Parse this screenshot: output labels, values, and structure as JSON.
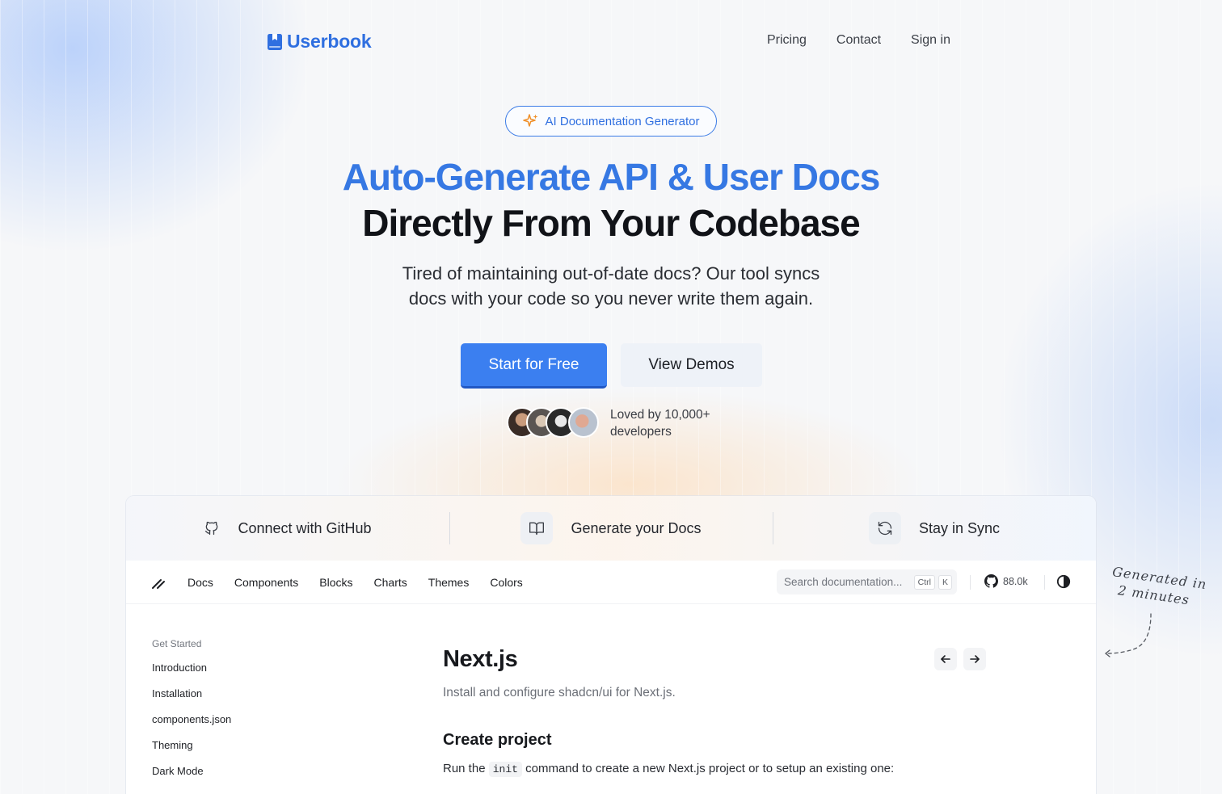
{
  "brand": {
    "name": "Userbook",
    "color": "#2f6fe0"
  },
  "nav": {
    "items": [
      "Pricing",
      "Contact",
      "Sign in"
    ]
  },
  "hero": {
    "badge": "AI Documentation Generator",
    "headline_blue": "Auto-Generate API & User Docs",
    "headline_dark": "Directly From Your Codebase",
    "subtitle_line1": "Tired of maintaining out-of-date docs? Our tool syncs",
    "subtitle_line2": "docs with your code so you never write them again.",
    "cta_primary": "Start for Free",
    "cta_secondary": "View Demos",
    "social_proof_line1": "Loved by 10,000+",
    "social_proof_line2": "developers"
  },
  "steps": [
    {
      "label": "Connect with GitHub",
      "icon": "github-icon"
    },
    {
      "label": "Generate your Docs",
      "icon": "book-icon"
    },
    {
      "label": "Stay in Sync",
      "icon": "refresh-icon"
    }
  ],
  "docs": {
    "nav_links": [
      "Docs",
      "Components",
      "Blocks",
      "Charts",
      "Themes",
      "Colors"
    ],
    "search_placeholder": "Search documentation...",
    "kbd_ctrl": "Ctrl",
    "kbd_k": "K",
    "github_stars": "88.0k",
    "sidebar_heading": "Get Started",
    "sidebar_items": [
      "Introduction",
      "Installation",
      "components.json",
      "Theming",
      "Dark Mode"
    ],
    "page_title": "Next.js",
    "page_description": "Install and configure shadcn/ui for Next.js.",
    "section_title": "Create project",
    "section_text_before": "Run the",
    "section_code": "init",
    "section_text_after": "command to create a new Next.js project or to setup an existing one:"
  },
  "annotation": {
    "line1": "Generated in",
    "line2": "2 minutes"
  },
  "colors": {
    "accent": "#3b7ff0",
    "headline_blue": "#3678e3"
  }
}
